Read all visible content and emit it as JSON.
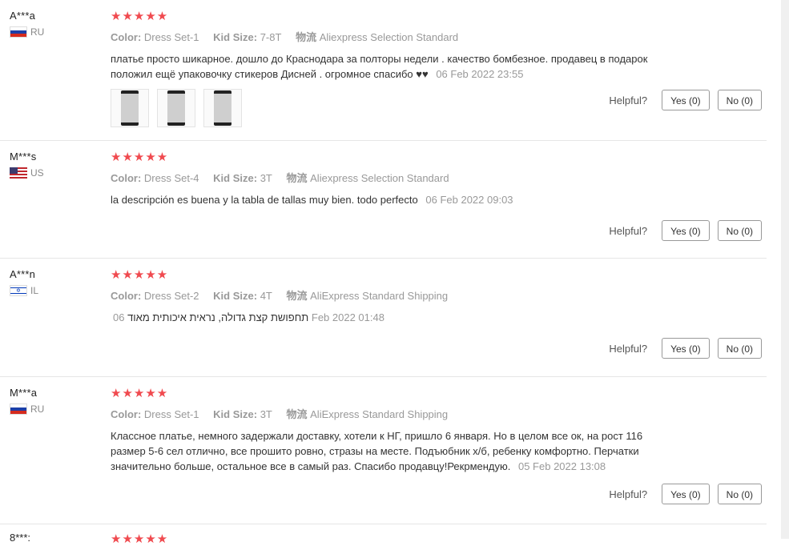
{
  "labels": {
    "color": "Color:",
    "kid_size": "Kid Size:",
    "logistics": "物流",
    "helpful": "Helpful?"
  },
  "stars": "★★★★★",
  "reviews": [
    {
      "user": "A***a",
      "country": "RU",
      "color": "Dress Set-1",
      "kid_size": "7-8T",
      "shipping": "Aliexpress Selection Standard",
      "text_line1": "платье просто шикарное. дошло до Краснодара за полторы недели . качество бомбезное. продавец в подарок",
      "text_line2": "положил ещё упаковочку стикеров Дисней . огромное спасибо ♥♥",
      "date": "06 Feb 2022 23:55",
      "yes": "Yes (0)",
      "no": "No (0)"
    },
    {
      "user": "M***s",
      "country": "US",
      "color": "Dress Set-4",
      "kid_size": "3T",
      "shipping": "Aliexpress Selection Standard",
      "text_line1": "la descripción es buena y la tabla de tallas muy bien. todo perfecto",
      "date": "06 Feb 2022 09:03",
      "yes": "Yes (0)",
      "no": "No (0)"
    },
    {
      "user": "A***n",
      "country": "IL",
      "color": "Dress Set-2",
      "kid_size": "4T",
      "shipping": "AliExpress Standard Shipping",
      "text_line1": "תחפושת קצת גדולה, נראית איכותית מאוד",
      "date_day": "06",
      "date_rest": "Feb 2022 01:48",
      "yes": "Yes (0)",
      "no": "No (0)"
    },
    {
      "user": "M***a",
      "country": "RU",
      "color": "Dress Set-1",
      "kid_size": "3T",
      "shipping": "AliExpress Standard Shipping",
      "text_line1": "Классное платье, немного задержали доставку, хотели к НГ, пришло 6 января. Но в целом все ок, на рост 116",
      "text_line2": "размер 5-6 сел отлично, все прошито ровно, стразы на месте. Подъюбник х/б, ребенку комфортно. Перчатки",
      "text_line3": "значительно больше, остальное все в самый раз. Спасибо продавцу!Рекрмендую.",
      "date": "05 Feb 2022 13:08",
      "yes": "Yes (0)",
      "no": "No (0)"
    }
  ],
  "partial_review": {
    "user": "8***:"
  }
}
